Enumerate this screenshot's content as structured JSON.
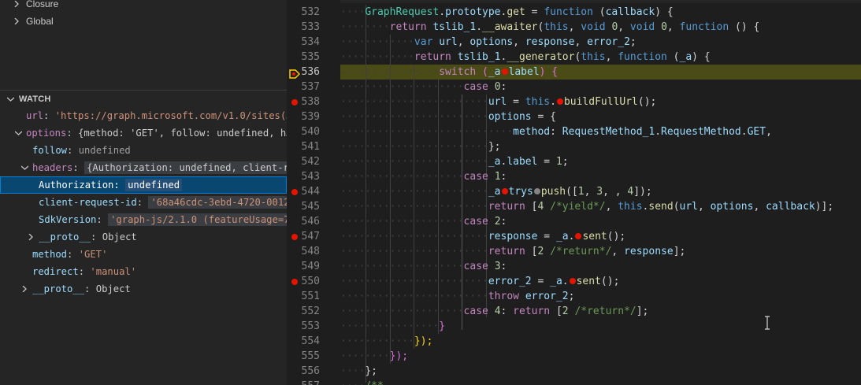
{
  "scopes": [
    {
      "label": "Closure"
    },
    {
      "label": "Global"
    }
  ],
  "watch": {
    "header": "WATCH",
    "rows": [
      {
        "name": "url",
        "sep": ": ",
        "value": "'https://graph.microsoft.com/v1.0/sites(…"
      },
      {
        "name": "options",
        "sep": ": ",
        "value": "{method: 'GET', follow: undefined, h…"
      },
      {
        "name": "follow",
        "sep": ": ",
        "value": "undefined"
      },
      {
        "name": "headers",
        "sep": ": ",
        "value": "{Authorization: undefined, client-r…"
      },
      {
        "name": "Authorization",
        "sep": ": ",
        "value": "undefined"
      },
      {
        "name": "client-request-id",
        "sep": ": ",
        "value": "'68a46cdc-3ebd-4720-0012…"
      },
      {
        "name": "SdkVersion",
        "sep": ": ",
        "value": "'graph-js/2.1.0 (featureUsage=7…"
      },
      {
        "name": "__proto__",
        "sep": ": ",
        "value": "Object"
      },
      {
        "name": "method",
        "sep": ": ",
        "value": "'GET'"
      },
      {
        "name": "redirect",
        "sep": ": ",
        "value": "'manual'"
      },
      {
        "name": "__proto__",
        "sep": ": ",
        "value": "Object"
      }
    ]
  },
  "editor": {
    "line_numbers": [
      "532",
      "533",
      "534",
      "535",
      "536",
      "537",
      "538",
      "539",
      "540",
      "541",
      "542",
      "543",
      "544",
      "545",
      "546",
      "547",
      "548",
      "549",
      "550",
      "551",
      "552",
      "553",
      "554",
      "555",
      "556",
      "557"
    ],
    "lines": {
      "l532": {
        "a": "GraphRequest",
        "b": ".",
        "c": "prototype",
        "d": ".",
        "e": "get",
        "f": " = ",
        "g": "function",
        "h": " (",
        "i": "callback",
        "j": ") {"
      },
      "l533": {
        "a": "return",
        "b": " ",
        "c": "tslib_1",
        "d": ".",
        "e": "__awaiter",
        "f": "(",
        "g": "this",
        "h": ", ",
        "i": "void",
        "j": " ",
        "k": "0",
        "l": ", ",
        "m": "void",
        "n": " ",
        "o": "0",
        "p": ", ",
        "q": "function",
        "r": " () {"
      },
      "l534": {
        "a": "var",
        "b": " ",
        "c": "url",
        "d": ", ",
        "e": "options",
        "f": ", ",
        "g": "response",
        "h": ", ",
        "i": "error_2",
        "j": ";"
      },
      "l535": {
        "a": "return",
        "b": " ",
        "c": "tslib_1",
        "d": ".",
        "e": "__generator",
        "f": "(",
        "g": "this",
        "h": ", ",
        "i": "function",
        "j": " (",
        "k": "_a",
        "l": ") {"
      },
      "l536": {
        "a": "switch",
        "b": " (",
        "c": "_a",
        "d": ".",
        "e": "label",
        "f": ") {"
      },
      "l537": {
        "a": "case",
        "b": " ",
        "c": "0",
        "d": ":"
      },
      "l538": {
        "a": "url",
        "b": " = ",
        "c": "this",
        "d": ".",
        "e": "buildFullUrl",
        "f": "();"
      },
      "l539": {
        "a": "options",
        "b": " = {"
      },
      "l540": {
        "a": "method",
        "b": ": ",
        "c": "RequestMethod_1",
        "d": ".",
        "e": "RequestMethod",
        "f": ".",
        "g": "GET",
        "h": ","
      },
      "l541": {
        "a": "};"
      },
      "l542": {
        "a": "_a",
        "b": ".",
        "c": "label",
        "d": " = ",
        "e": "1",
        "f": ";"
      },
      "l543": {
        "a": "case",
        "b": " ",
        "c": "1",
        "d": ":"
      },
      "l544": {
        "a": "_a",
        "b": ".",
        "c": "trys",
        "d": ".",
        "e": "push",
        "f": "([",
        "g": "1",
        "h": ", ",
        "i": "3",
        "j": ", , ",
        "k": "4",
        "l": "]);"
      },
      "l545": {
        "a": "return",
        "b": " [",
        "c": "4",
        "d": " ",
        "e": "/*yield*/",
        "f": ", ",
        "g": "this",
        "h": ".",
        "i": "send",
        "j": "(",
        "k": "url",
        "l": ", ",
        "m": "options",
        "n": ", ",
        "o": "callback",
        "p": ")];"
      },
      "l546": {
        "a": "case",
        "b": " ",
        "c": "2",
        "d": ":"
      },
      "l547": {
        "a": "response",
        "b": " = ",
        "c": "_a",
        "d": ".",
        "e": "sent",
        "f": "();"
      },
      "l548": {
        "a": "return",
        "b": " [",
        "c": "2",
        "d": " ",
        "e": "/*return*/",
        "f": ", ",
        "g": "response",
        "h": "];"
      },
      "l549": {
        "a": "case",
        "b": " ",
        "c": "3",
        "d": ":"
      },
      "l550": {
        "a": "error_2",
        "b": " = ",
        "c": "_a",
        "d": ".",
        "e": "sent",
        "f": "();"
      },
      "l551": {
        "a": "throw",
        "b": " ",
        "c": "error_2",
        "d": ";"
      },
      "l552": {
        "a": "case",
        "b": " ",
        "c": "4",
        "d": ": ",
        "e": "return",
        "f": " [",
        "g": "2",
        "h": " ",
        "i": "/*return*/",
        "j": "];"
      },
      "l553": {
        "a": "}"
      },
      "l554": {
        "a": "});"
      },
      "l555": {
        "a": "});"
      },
      "l556": {
        "a": "};"
      },
      "l557": {
        "a": "/**"
      }
    }
  },
  "colors": {
    "sidebar_bg": "#252526",
    "editor_bg": "#1e1e1e",
    "selection": "#094771",
    "breakpoint": "#e51400",
    "current_line": "#4b4b18"
  }
}
